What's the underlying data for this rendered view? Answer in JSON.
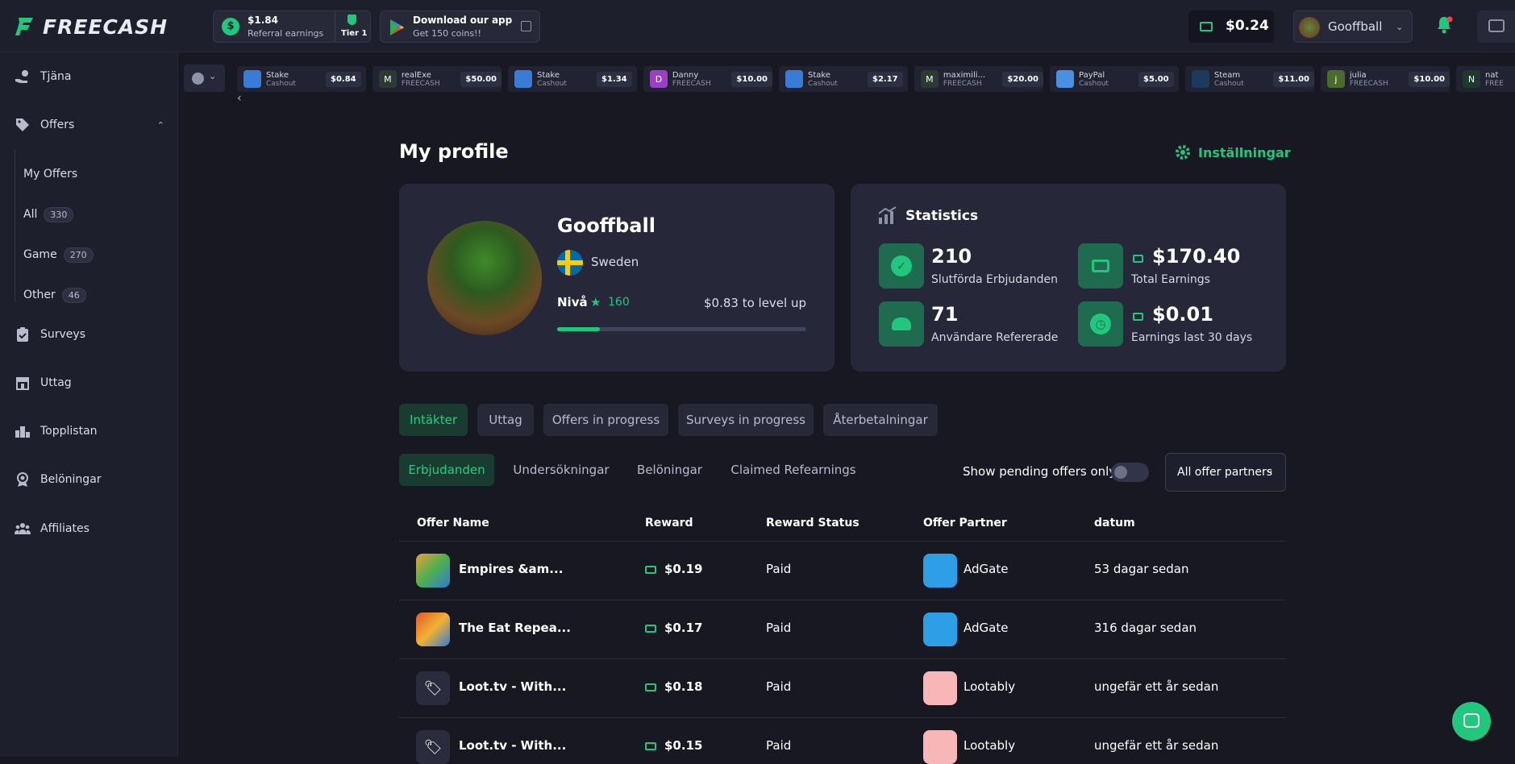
{
  "brand": {
    "name": "FREECASH",
    "accent": "#22c77e"
  },
  "header": {
    "referral": {
      "amount": "$1.84",
      "label": "Referral earnings",
      "tier": "Tier 1"
    },
    "app_promo": {
      "title": "Download our app",
      "subtitle": "Get 150 coins!!"
    },
    "balance": "$0.24",
    "username": "Gooffball"
  },
  "ticker": [
    {
      "name": "Stake",
      "sub": "Cashout",
      "amount": "$0.84",
      "color": "#3a7bd5",
      "icon": "stake-icon"
    },
    {
      "name": "realExe",
      "sub": "FREECASH",
      "amount": "$50.00",
      "color": "#2c3a33",
      "letter": "M"
    },
    {
      "name": "Stake",
      "sub": "Cashout",
      "amount": "$1.34",
      "color": "#3a7bd5",
      "icon": "stake-icon"
    },
    {
      "name": "Danny",
      "sub": "FREECASH",
      "amount": "$10.00",
      "color": "#9b3fc4",
      "letter": "D"
    },
    {
      "name": "Stake",
      "sub": "Cashout",
      "amount": "$2.17",
      "color": "#3a7bd5",
      "icon": "stake-icon"
    },
    {
      "name": "maximili...",
      "sub": "FREECASH",
      "amount": "$20.00",
      "color": "#2c3a33",
      "letter": "M"
    },
    {
      "name": "PayPal",
      "sub": "Cashout",
      "amount": "$5.00",
      "color": "#4a90e2",
      "icon": "paypal-icon"
    },
    {
      "name": "Steam",
      "sub": "Cashout",
      "amount": "$11.00",
      "color": "#1b3a5c",
      "icon": "steam-icon"
    },
    {
      "name": "julia",
      "sub": "FREECASH",
      "amount": "$10.00",
      "color": "#4a6b2a",
      "letter": "j"
    },
    {
      "name": "nat",
      "sub": "FREE",
      "amount": "",
      "color": "#1e3a2f",
      "letter": "N"
    }
  ],
  "sidebar": {
    "items": [
      {
        "label": "Tjäna",
        "icon": "hand-coin-icon"
      },
      {
        "label": "Offers",
        "icon": "tag-icon"
      },
      {
        "label": "Surveys",
        "icon": "clipboard-icon"
      },
      {
        "label": "Uttag",
        "icon": "store-icon"
      },
      {
        "label": "Topplistan",
        "icon": "leaderboard-icon"
      },
      {
        "label": "Belöningar",
        "icon": "award-icon"
      },
      {
        "label": "Affiliates",
        "icon": "users-icon"
      }
    ],
    "offers_sub": [
      {
        "label": "My Offers",
        "count": ""
      },
      {
        "label": "All",
        "count": "330"
      },
      {
        "label": "Game",
        "count": "270"
      },
      {
        "label": "Other",
        "count": "46"
      }
    ]
  },
  "profile": {
    "title": "My profile",
    "settings": "Inställningar",
    "name": "Gooffball",
    "country": "Sweden",
    "level_label": "Nivå",
    "level": "160",
    "to_level_up": "$0.83 to level up",
    "progress": 0.17
  },
  "stats": {
    "title": "Statistics",
    "items": [
      {
        "value": "210",
        "label": "Slutförda Erbjudanden",
        "icon": "check-icon"
      },
      {
        "value": "$170.40",
        "label": "Total Earnings",
        "icon": "wallet-icon"
      },
      {
        "value": "71",
        "label": "Användare Refererade",
        "icon": "users-icon"
      },
      {
        "value": "$0.01",
        "label": "Earnings last 30 days",
        "icon": "clock-icon"
      }
    ]
  },
  "tabs": [
    "Intäkter",
    "Uttag",
    "Offers in progress",
    "Surveys in progress",
    "Återbetalningar"
  ],
  "subtabs": [
    "Erbjudanden",
    "Undersökningar",
    "Belöningar",
    "Claimed Refearnings"
  ],
  "filters": {
    "pending_label": "Show pending offers only",
    "partners": "All offer partners"
  },
  "table": {
    "headers": [
      "Offer Name",
      "Reward",
      "Reward Status",
      "Offer Partner",
      "datum"
    ],
    "rows": [
      {
        "name": "Empires &am...",
        "reward": "$0.19",
        "status": "Paid",
        "partner": "AdGate",
        "date": "53 dagar sedan"
      },
      {
        "name": "The Eat Repea...",
        "reward": "$0.17",
        "status": "Paid",
        "partner": "AdGate",
        "date": "316 dagar sedan"
      },
      {
        "name": "Loot.tv - With...",
        "reward": "$0.18",
        "status": "Paid",
        "partner": "Lootably",
        "date": "ungefär ett år sedan"
      },
      {
        "name": "Loot.tv - With...",
        "reward": "$0.15",
        "status": "Paid",
        "partner": "Lootably",
        "date": "ungefär ett år sedan"
      }
    ]
  }
}
